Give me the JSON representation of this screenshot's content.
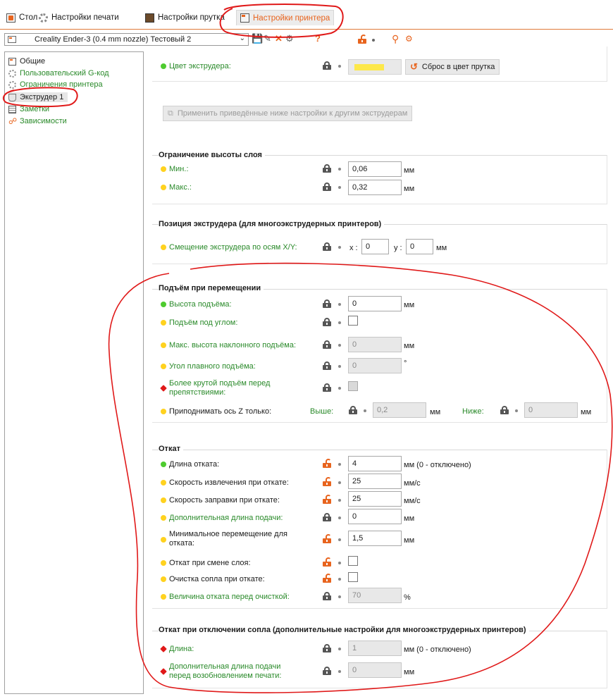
{
  "tabs": [
    {
      "label": "Стол",
      "active": false
    },
    {
      "label": "Настройки печати",
      "active": false
    },
    {
      "label": "Настройки прутка",
      "active": false
    },
    {
      "label": "Настройки принтера",
      "active": true
    }
  ],
  "preset": {
    "name": "Creality Ender-3 (0.4 mm nozzle) Тестовый 2"
  },
  "sidebar": {
    "items": [
      {
        "label": "Общие",
        "color": "#1a1a1a"
      },
      {
        "label": "Пользовательский G-код",
        "color": "#2a8a2a"
      },
      {
        "label": "Ограничения принтера",
        "color": "#2a8a2a"
      },
      {
        "label": "Экструдер 1",
        "color": "#1a1a1a",
        "selected": true
      },
      {
        "label": "Заметки",
        "color": "#2a8a2a"
      },
      {
        "label": "Зависимости",
        "color": "#2a8a2a"
      }
    ]
  },
  "extruder_color": {
    "label": "Цвет экструдера:",
    "swatch": "#fde84a",
    "reset_label": "Сброс в цвет прутка"
  },
  "apply_button": "Применить приведённые ниже настройки к другим экструдерам",
  "layer_height": {
    "title": "Ограничение высоты слоя",
    "min_label": "Мин.:",
    "min_value": "0,06",
    "min_unit": "мм",
    "max_label": "Макс.:",
    "max_value": "0,32",
    "max_unit": "мм"
  },
  "position": {
    "title": "Позиция экструдера (для многоэкструдерных принтеров)",
    "offset_label": "Смещение экструдера по осям X/Y:",
    "x_label": "x :",
    "x_value": "0",
    "y_label": "y :",
    "y_value": "0",
    "unit": "мм"
  },
  "lift": {
    "title": "Подъём при перемещении",
    "height_label": "Высота подъёма:",
    "height_value": "0",
    "height_unit": "мм",
    "ramp_label": "Подъём под углом:",
    "max_ramp_label": "Макс. высота наклонного подъёма:",
    "max_ramp_value": "0",
    "max_ramp_unit": "мм",
    "angle_label": "Угол плавного подъёма:",
    "angle_value": "0",
    "angle_unit": "°",
    "steep_label_1": "Более крутой подъём перед",
    "steep_label_2": "препятствиями:",
    "only_label": "Приподнимать ось Z только:",
    "above_label": "Выше:",
    "above_value": "0,2",
    "above_unit": "мм",
    "below_label": "Ниже:",
    "below_value": "0",
    "below_unit": "мм"
  },
  "retract": {
    "title": "Откат",
    "length_label": "Длина отката:",
    "length_value": "4",
    "length_unit": "мм (0 - отключено)",
    "speed_label": "Скорость извлечения при откате:",
    "speed_value": "25",
    "speed_unit": "мм/с",
    "deretract_label": "Скорость заправки при откате:",
    "deretract_value": "25",
    "deretract_unit": "мм/с",
    "extra_label": "Дополнительная длина подачи:",
    "extra_value": "0",
    "extra_unit": "мм",
    "min_travel_label_1": "Минимальное перемещение для",
    "min_travel_label_2": "отката:",
    "min_travel_value": "1,5",
    "min_travel_unit": "мм",
    "layer_change_label": "Откат при смене слоя:",
    "wipe_label": "Очистка сопла при откате:",
    "before_wipe_label": "Величина отката перед очисткой:",
    "before_wipe_value": "70",
    "before_wipe_unit": "%"
  },
  "toolchange": {
    "title": "Откат при отключении сопла (дополнительные настройки для многоэкструдерных принтеров)",
    "length_label": "Длина:",
    "length_value": "1",
    "length_unit": "мм (0 - отключено)",
    "extra_label_1": "Дополнительная длина подачи",
    "extra_label_2": "перед возобновлением печати:",
    "extra_value": "0",
    "extra_unit": "мм"
  },
  "colors": {
    "accent": "#e8641e",
    "annotation": "#e01919",
    "green_text": "#2a8a2a"
  }
}
